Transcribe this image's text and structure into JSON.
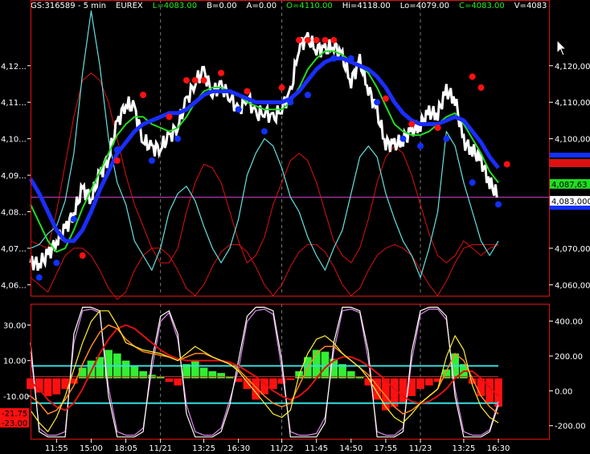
{
  "header": {
    "symbol": "GS:316589 - 5 min",
    "exchange": "EUREX",
    "last": "L=4083.00",
    "bid": "B=0.00",
    "ask": "A=0.00",
    "open": "O=4110.00",
    "high": "Hi=4118.00",
    "low": "Lo=4079.00",
    "close": "C=4083.00",
    "volume": "V=4083"
  },
  "colors": {
    "background": "#000000",
    "price_bars": "#ffffff",
    "ma_fast": "#22dd22",
    "ma_slow": "#1a2eff",
    "cyan_line": "#66e0e0",
    "channel": "#dd1111",
    "dots_high": "#ff1010",
    "dots_low": "#1030ff",
    "hist_pos": "#33ee33",
    "hist_neg": "#ff1010"
  },
  "chart_data": [
    {
      "type": "line",
      "pane": "price",
      "ylim": [
        4057,
        4138
      ],
      "y_ticks_left": [
        "4,12...",
        "4,11...",
        "4,10...",
        "4,09...",
        "4,08...",
        "4,07...",
        "4,06..."
      ],
      "y_ticks_left_values": [
        4120,
        4110,
        4100,
        4090,
        4080,
        4070,
        4060
      ],
      "y_ticks_right": [
        "4,120,00",
        "4,110,000",
        "4,100,000",
        "4,070,000",
        "4,060,000"
      ],
      "y_ticks_right_values": [
        4120,
        4110,
        4100,
        4070,
        4060
      ],
      "price_labels": [
        {
          "text": "4,087,63",
          "value": 4087.63,
          "color": "#22dd22"
        },
        {
          "text": "4,083,000",
          "value": 4083,
          "color": "#ffffff"
        }
      ],
      "hline_magenta": 4084,
      "series": [
        {
          "key": "price",
          "values": [
            4066,
            4066,
            4068,
            4072,
            4075,
            4080,
            4086,
            4084,
            4090,
            4095,
            4104,
            4110,
            4108,
            4100,
            4097,
            4098,
            4100,
            4104,
            4110,
            4116,
            4118,
            4113,
            4114,
            4112,
            4107,
            4112,
            4106,
            4108,
            4105,
            4109,
            4112,
            4126,
            4127,
            4125,
            4124,
            4126,
            4122,
            4116,
            4121,
            4114,
            4107,
            4099,
            4098,
            4100,
            4102,
            4104,
            4107,
            4107,
            4113,
            4111,
            4099,
            4097,
            4094,
            4088,
            4084
          ]
        },
        {
          "key": "ma_fast",
          "values": [
            4082,
            4077,
            4072,
            4069,
            4070,
            4075,
            4081,
            4086,
            4091,
            4096,
            4101,
            4104,
            4106,
            4106,
            4104,
            4103,
            4102,
            4103,
            4106,
            4110,
            4113,
            4114,
            4114,
            4113,
            4112,
            4110,
            4109,
            4108,
            4108,
            4108,
            4110,
            4114,
            4119,
            4122,
            4124,
            4124,
            4123,
            4121,
            4120,
            4118,
            4114,
            4109,
            4104,
            4102,
            4101,
            4101,
            4102,
            4104,
            4106,
            4107,
            4104,
            4100,
            4096,
            4091,
            4088
          ]
        },
        {
          "key": "ma_slow",
          "values": [
            4089,
            4085,
            4080,
            4075,
            4072,
            4072,
            4075,
            4080,
            4086,
            4091,
            4096,
            4099,
            4102,
            4104,
            4105,
            4106,
            4107,
            4107,
            4108,
            4110,
            4112,
            4113,
            4113,
            4113,
            4112,
            4111,
            4110,
            4110,
            4110,
            4110,
            4111,
            4113,
            4116,
            4119,
            4121,
            4122,
            4122,
            4121,
            4120,
            4119,
            4117,
            4114,
            4110,
            4107,
            4105,
            4104,
            4104,
            4104,
            4105,
            4106,
            4105,
            4102,
            4099,
            4095,
            4092
          ]
        },
        {
          "key": "cyan",
          "values": [
            4070,
            4071,
            4074,
            4076,
            4083,
            4096,
            4118,
            4135,
            4120,
            4100,
            4088,
            4082,
            4072,
            4068,
            4064,
            4070,
            4080,
            4085,
            4087,
            4083,
            4076,
            4070,
            4066,
            4070,
            4078,
            4090,
            4096,
            4100,
            4098,
            4092,
            4084,
            4080,
            4073,
            4068,
            4064,
            4070,
            4075,
            4085,
            4095,
            4098,
            4095,
            4085,
            4078,
            4072,
            4068,
            4062,
            4070,
            4080,
            4102,
            4098,
            4088,
            4080,
            4072,
            4068,
            4072
          ]
        },
        {
          "key": "channel_top",
          "values": [
            4072,
            4071,
            4070,
            4080,
            4093,
            4106,
            4116,
            4118,
            4116,
            4110,
            4100,
            4090,
            4082,
            4076,
            4070,
            4066,
            4066,
            4070,
            4080,
            4088,
            4093,
            4092,
            4088,
            4080,
            4072,
            4066,
            4068,
            4073,
            4082,
            4088,
            4094,
            4096,
            4094,
            4088,
            4080,
            4072,
            4068,
            4066,
            4070,
            4078,
            4088,
            4095,
            4098,
            4096,
            4090,
            4082,
            4074,
            4068,
            4066,
            4068,
            4072,
            4070,
            4068,
            4070,
            4071
          ]
        },
        {
          "key": "channel_bot",
          "values": [
            4062,
            4060,
            4058,
            4063,
            4068,
            4070,
            4070,
            4068,
            4064,
            4059,
            4056,
            4058,
            4064,
            4068,
            4070,
            4070,
            4068,
            4064,
            4059,
            4057,
            4060,
            4065,
            4069,
            4071,
            4071,
            4069,
            4065,
            4060,
            4057,
            4060,
            4065,
            4069,
            4071,
            4071,
            4069,
            4065,
            4060,
            4057,
            4059,
            4064,
            4068,
            4070,
            4071,
            4070,
            4068,
            4064,
            4060,
            4057,
            4061,
            4066,
            4070,
            4071,
            4071,
            4071,
            4071
          ]
        }
      ],
      "dots_high": [
        [
          6,
          4068
        ],
        [
          10,
          4094
        ],
        [
          13,
          4112
        ],
        [
          16,
          4106
        ],
        [
          18,
          4116
        ],
        [
          19,
          4116
        ],
        [
          20,
          4116
        ],
        [
          22,
          4118
        ],
        [
          25,
          4113
        ],
        [
          29,
          4114
        ],
        [
          31,
          4127
        ],
        [
          32,
          4127
        ],
        [
          33,
          4127
        ],
        [
          34,
          4127
        ],
        [
          35,
          4127
        ],
        [
          41,
          4111
        ],
        [
          44,
          4104
        ],
        [
          47,
          4103
        ],
        [
          51,
          4117
        ],
        [
          52,
          4114
        ],
        [
          55,
          4093
        ]
      ],
      "dots_low": [
        [
          1,
          4062
        ],
        [
          3,
          4066
        ],
        [
          5,
          4078
        ],
        [
          10,
          4097
        ],
        [
          14,
          4094
        ],
        [
          17,
          4100
        ],
        [
          24,
          4108
        ],
        [
          27,
          4102
        ],
        [
          30,
          4110
        ],
        [
          32,
          4112
        ],
        [
          35,
          4122
        ],
        [
          37,
          4122
        ],
        [
          40,
          4110
        ],
        [
          43,
          4100
        ],
        [
          45,
          4098
        ],
        [
          48,
          4100
        ],
        [
          51,
          4088
        ],
        [
          54,
          4082
        ]
      ]
    },
    {
      "type": "line",
      "pane": "oscillator",
      "ylim_left": [
        -34,
        42
      ],
      "ylim_right": [
        -275,
        500
      ],
      "y_ticks_left": [
        "30.00",
        "10.00",
        "-10.00"
      ],
      "y_ticks_left_values": [
        30,
        10,
        -10
      ],
      "y_ticks_right": [
        "400.00",
        "200.00",
        "0.00",
        "-200.00"
      ],
      "y_ticks_right_values": [
        400,
        200,
        0,
        -200
      ],
      "value_labels": [
        {
          "text": "-21.75",
          "value": -21.75,
          "color": "#ff1010"
        },
        {
          "text": "-23.00",
          "value": -23.0,
          "color": "#ff1010"
        }
      ],
      "hlines_cyan": [
        7,
        -14
      ],
      "hline_red": 1,
      "histogram": [
        -6,
        -8,
        -10,
        -9,
        -6,
        -3,
        6,
        10,
        12,
        16,
        14,
        10,
        7,
        4,
        2,
        1,
        -2,
        -4,
        8,
        10,
        6,
        4,
        3,
        1,
        -2,
        -6,
        -12,
        -9,
        -6,
        -3,
        -1,
        4,
        12,
        16,
        15,
        11,
        8,
        4,
        1,
        -4,
        -12,
        -18,
        -16,
        -14,
        -10,
        -6,
        -4,
        -2,
        5,
        14,
        8,
        -3,
        -10,
        -14,
        -16
      ],
      "series": [
        {
          "key": "osc_yellow",
          "values": [
            -18,
            -25,
            -30,
            -22,
            -10,
            5,
            20,
            32,
            38,
            38,
            30,
            20,
            18,
            16,
            15,
            14,
            12,
            10,
            14,
            18,
            15,
            12,
            10,
            8,
            4,
            -2,
            -8,
            -14,
            -20,
            -22,
            -18,
            2,
            14,
            22,
            24,
            20,
            14,
            10,
            6,
            0,
            -8,
            -16,
            -22,
            -25,
            -20,
            -14,
            -10,
            -6,
            12,
            24,
            16,
            -4,
            -16,
            -22,
            -25
          ]
        },
        {
          "key": "osc_orange",
          "values": [
            -10,
            -14,
            -20,
            -18,
            -12,
            -4,
            8,
            18,
            26,
            30,
            28,
            22,
            18,
            15,
            14,
            13,
            12,
            10,
            12,
            14,
            14,
            12,
            10,
            8,
            5,
            0,
            -5,
            -10,
            -14,
            -16,
            -14,
            -4,
            6,
            14,
            18,
            18,
            14,
            10,
            6,
            2,
            -4,
            -10,
            -16,
            -20,
            -18,
            -14,
            -10,
            -6,
            4,
            14,
            10,
            0,
            -10,
            -16,
            -20
          ]
        },
        {
          "key": "osc_red",
          "values": [
            -2,
            -6,
            -12,
            -16,
            -18,
            -14,
            -6,
            4,
            14,
            22,
            28,
            30,
            28,
            24,
            20,
            16,
            13,
            11,
            10,
            10,
            10,
            10,
            10,
            9,
            7,
            4,
            1,
            -3,
            -7,
            -10,
            -12,
            -10,
            -6,
            0,
            6,
            10,
            12,
            12,
            10,
            7,
            3,
            -1,
            -6,
            -10,
            -13,
            -14,
            -13,
            -10,
            -6,
            0,
            4,
            4,
            0,
            -5,
            -10
          ]
        },
        {
          "key": "osc_white",
          "values": [
            20,
            -30,
            -33,
            -33,
            -33,
            25,
            40,
            40,
            38,
            -10,
            -33,
            -33,
            -33,
            -30,
            10,
            35,
            38,
            25,
            -20,
            -33,
            -33,
            -33,
            -30,
            -15,
            10,
            35,
            40,
            40,
            38,
            10,
            -33,
            -33,
            -33,
            -33,
            -25,
            20,
            40,
            40,
            38,
            15,
            -33,
            -33,
            -33,
            -30,
            15,
            38,
            40,
            40,
            35,
            -10,
            -33,
            -33,
            -33,
            -30,
            -15
          ]
        },
        {
          "key": "osc_magenta",
          "values": [
            15,
            -28,
            -32,
            -32,
            -30,
            20,
            38,
            39,
            37,
            -5,
            -30,
            -32,
            -32,
            -28,
            5,
            32,
            37,
            22,
            -15,
            -30,
            -32,
            -32,
            -28,
            -12,
            5,
            32,
            38,
            39,
            36,
            5,
            -30,
            -32,
            -32,
            -31,
            -22,
            15,
            38,
            39,
            37,
            10,
            -30,
            -32,
            -32,
            -28,
            10,
            36,
            39,
            39,
            33,
            -6,
            -30,
            -32,
            -32,
            -29,
            -13
          ]
        }
      ]
    }
  ],
  "x_ticks": [
    {
      "label": "11:55",
      "i": 3
    },
    {
      "label": "15:00",
      "i": 7
    },
    {
      "label": "18:05",
      "i": 11
    },
    {
      "label": "11/21",
      "i": 15
    },
    {
      "label": "13:25",
      "i": 20
    },
    {
      "label": "16:30",
      "i": 24
    },
    {
      "label": "11/22",
      "i": 29
    },
    {
      "label": "11:45",
      "i": 33
    },
    {
      "label": "14:50",
      "i": 37
    },
    {
      "label": "17:55",
      "i": 41
    },
    {
      "label": "11/23",
      "i": 45
    },
    {
      "label": "13:25",
      "i": 50
    },
    {
      "label": "16:30",
      "i": 54
    }
  ],
  "day_separators": [
    15,
    29,
    45
  ]
}
